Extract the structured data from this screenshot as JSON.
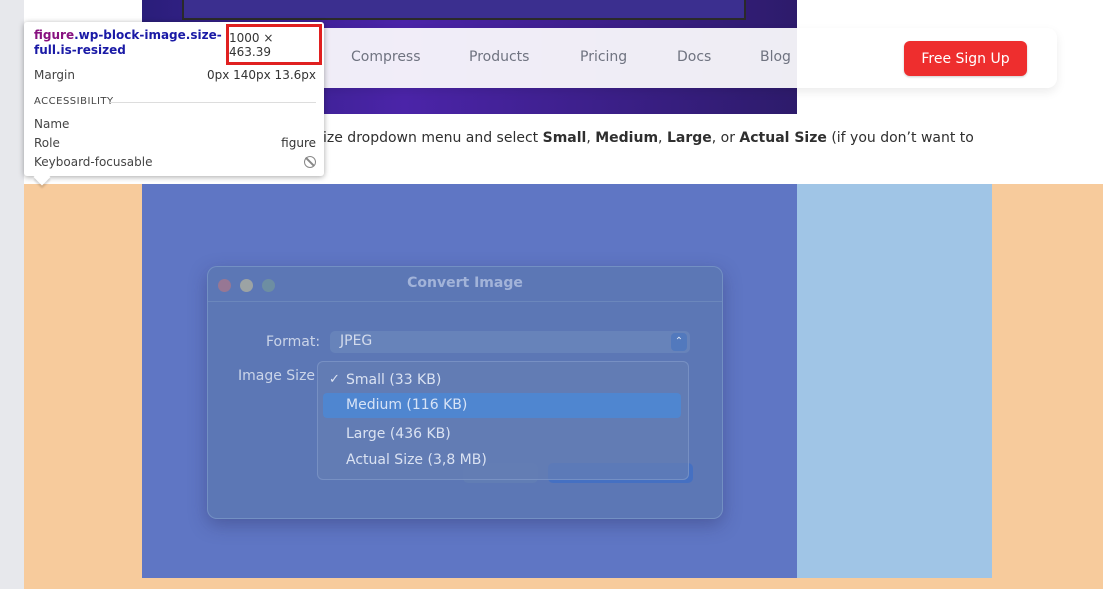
{
  "nav": {
    "items": [
      "Compress",
      "Products",
      "Pricing",
      "Docs",
      "Blog"
    ],
    "cta": "Free Sign Up"
  },
  "paragraph": {
    "text_before": "ize dropdown menu and select ",
    "opt1": "Small",
    "sep1": ", ",
    "opt2": "Medium",
    "sep2": ", ",
    "opt3": "Large",
    "sep3": ", or ",
    "opt4": "Actual Size",
    "text_after": " (if you don’t want to"
  },
  "dialog": {
    "title": "Convert Image",
    "format_label": "Format:",
    "format_value": "JPEG",
    "size_label": "Image Size",
    "size_options": [
      "Small (33 KB)",
      "Medium (116 KB)",
      "Large (436 KB)",
      "Actual Size (3,8 MB)"
    ],
    "checked_option": "Small (33 KB)",
    "hovered_option": "Medium (116 KB)"
  },
  "inspector": {
    "tag": "figure",
    "classes": ".wp-block-image.size-full.is-resized",
    "dimensions": "1000 × 463.39",
    "margin_label": "Margin",
    "margin_value": "0px 140px 13.6px",
    "section": "ACCESSIBILITY",
    "name_label": "Name",
    "role_label": "Role",
    "role_value": "figure",
    "focus_label": "Keyboard-focusable"
  },
  "colors": {
    "cta": "#ee2e2e",
    "margin_overlay": "#f7cb9c",
    "padding_overlay": "#a0c5e6",
    "content_overlay": "#5f76c4"
  }
}
